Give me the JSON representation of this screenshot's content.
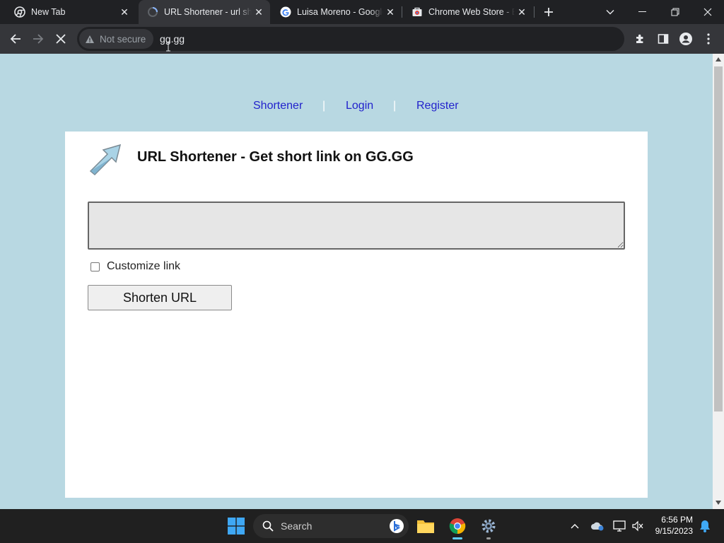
{
  "tabs": [
    {
      "title": "New Tab",
      "icon": "chrome-icon",
      "active": false
    },
    {
      "title": "URL Shortener - url shortener",
      "icon": "loading-favicon-icon",
      "active": true
    },
    {
      "title": "Luisa Moreno - Google Search",
      "icon": "google-icon",
      "active": false
    },
    {
      "title": "Chrome Web Store - Extensions",
      "icon": "web-store-icon",
      "active": false
    }
  ],
  "omnibox": {
    "security_label": "Not secure",
    "url": "gg.gg"
  },
  "page": {
    "nav": {
      "shortener": "Shortener",
      "login": "Login",
      "register": "Register",
      "separator": "|"
    },
    "heading": "URL Shortener - Get short link on GG.GG",
    "url_input_value": "",
    "customize_label": "Customize link",
    "customize_checked": false,
    "shorten_button": "Shorten URL"
  },
  "taskbar": {
    "search_label": "Search",
    "time": "6:56 PM",
    "date": "9/15/2023"
  },
  "colors": {
    "page_bg": "#b8d8e2",
    "link": "#2222cc",
    "chrome_dark": "#202124",
    "toolbar": "#35363a"
  }
}
